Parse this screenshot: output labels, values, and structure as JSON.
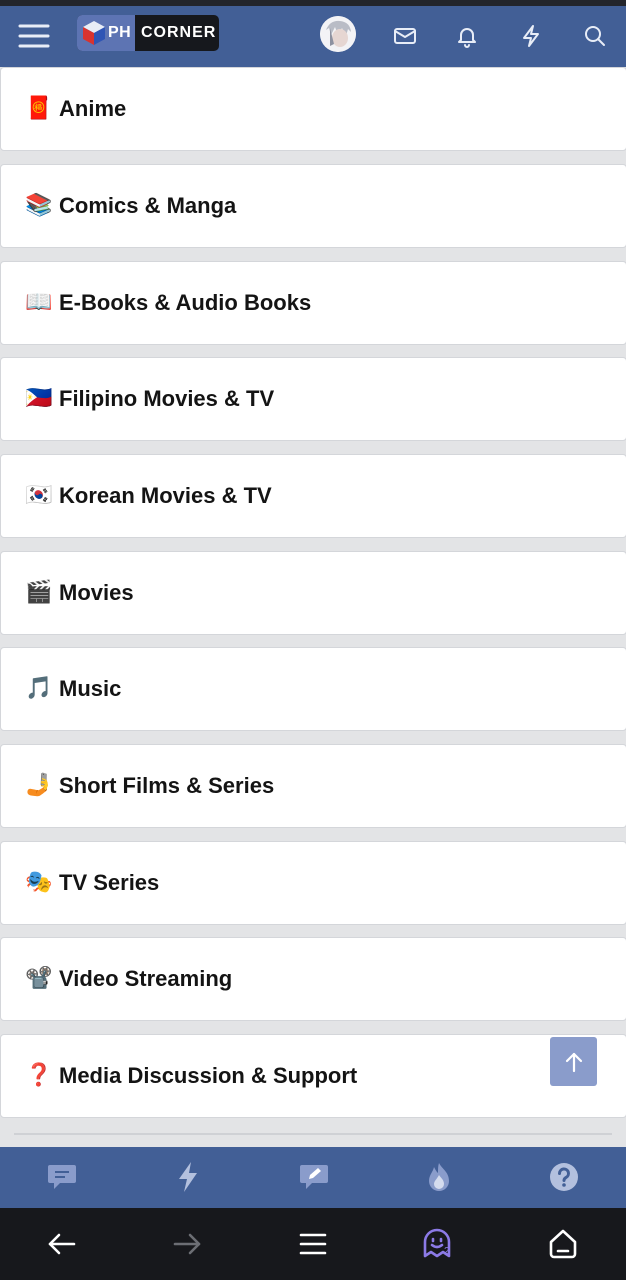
{
  "app": {
    "brand_short": "PH",
    "brand_word": "CORNER"
  },
  "topbar": {
    "menu_icon": "hamburger-menu-icon",
    "avatar_icon": "user-avatar",
    "icons": [
      "envelope-icon",
      "bell-icon",
      "lightning-icon",
      "search-icon"
    ]
  },
  "forums": [
    {
      "emoji": "🧧",
      "label": "Anime"
    },
    {
      "emoji": "📚",
      "label": "Comics & Manga"
    },
    {
      "emoji": "📖",
      "label": "E-Books & Audio Books"
    },
    {
      "emoji": "🇵🇭",
      "label": "Filipino Movies & TV"
    },
    {
      "emoji": "🇰🇷",
      "label": "Korean Movies & TV"
    },
    {
      "emoji": "🎬",
      "label": "Movies"
    },
    {
      "emoji": "🎵",
      "label": "Music"
    },
    {
      "emoji": "🤳",
      "label": "Short Films & Series"
    },
    {
      "emoji": "🎭",
      "label": "TV Series"
    },
    {
      "emoji": "📽️",
      "label": "Video Streaming"
    },
    {
      "emoji": "❓",
      "label": "Media Discussion & Support"
    }
  ],
  "bottom_nav": [
    "chat-bubble-icon",
    "lightning-icon",
    "edit-note-icon",
    "fire-icon",
    "help-icon"
  ],
  "system_nav": {
    "buttons": [
      "back-arrow-icon",
      "forward-arrow-icon",
      "menu-lines-icon",
      "ghost-tab-icon",
      "home-icon"
    ],
    "tab_count": "2"
  },
  "colors": {
    "header": "#425f96",
    "accent_button": "#8a9ccb",
    "system_bar": "#17181c"
  }
}
